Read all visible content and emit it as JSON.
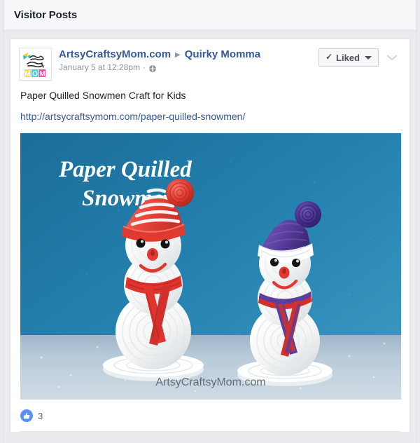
{
  "section": {
    "title": "Visitor Posts"
  },
  "post": {
    "avatar_alt": "ArtsyCraftsyMom logo",
    "author": "ArtsyCraftsyMom.com",
    "arrow": "▶",
    "target": "Quirky Momma",
    "timestamp": "January 5 at 12:28pm",
    "meta_separator": "·",
    "privacy_icon": "globe-icon",
    "message": "Paper Quilled Snowmen Craft for Kids",
    "link": "http://artsycraftsymom.com/paper-quilled-snowmen/",
    "liked_button": {
      "label": "Liked",
      "check": "✓"
    },
    "photo": {
      "title_line1": "Paper Quilled",
      "title_line2": "Snowmen",
      "watermark": "ArtsyCraftsyMom.com",
      "background_color": "#1f77a4",
      "left_snowman": {
        "hat_color": "#e8453c",
        "pom_color": "#d8332b",
        "scarf_color": "#e0342c"
      },
      "right_snowman": {
        "hat_color": "#5b3f9e",
        "pom_color": "#3f2a7a",
        "scarf_colors": [
          "#5b3f9e",
          "#d8332b"
        ]
      },
      "snow_color": "#b9c7d4"
    },
    "likes": {
      "count": "3",
      "icon": "thumbs-up-icon"
    }
  }
}
